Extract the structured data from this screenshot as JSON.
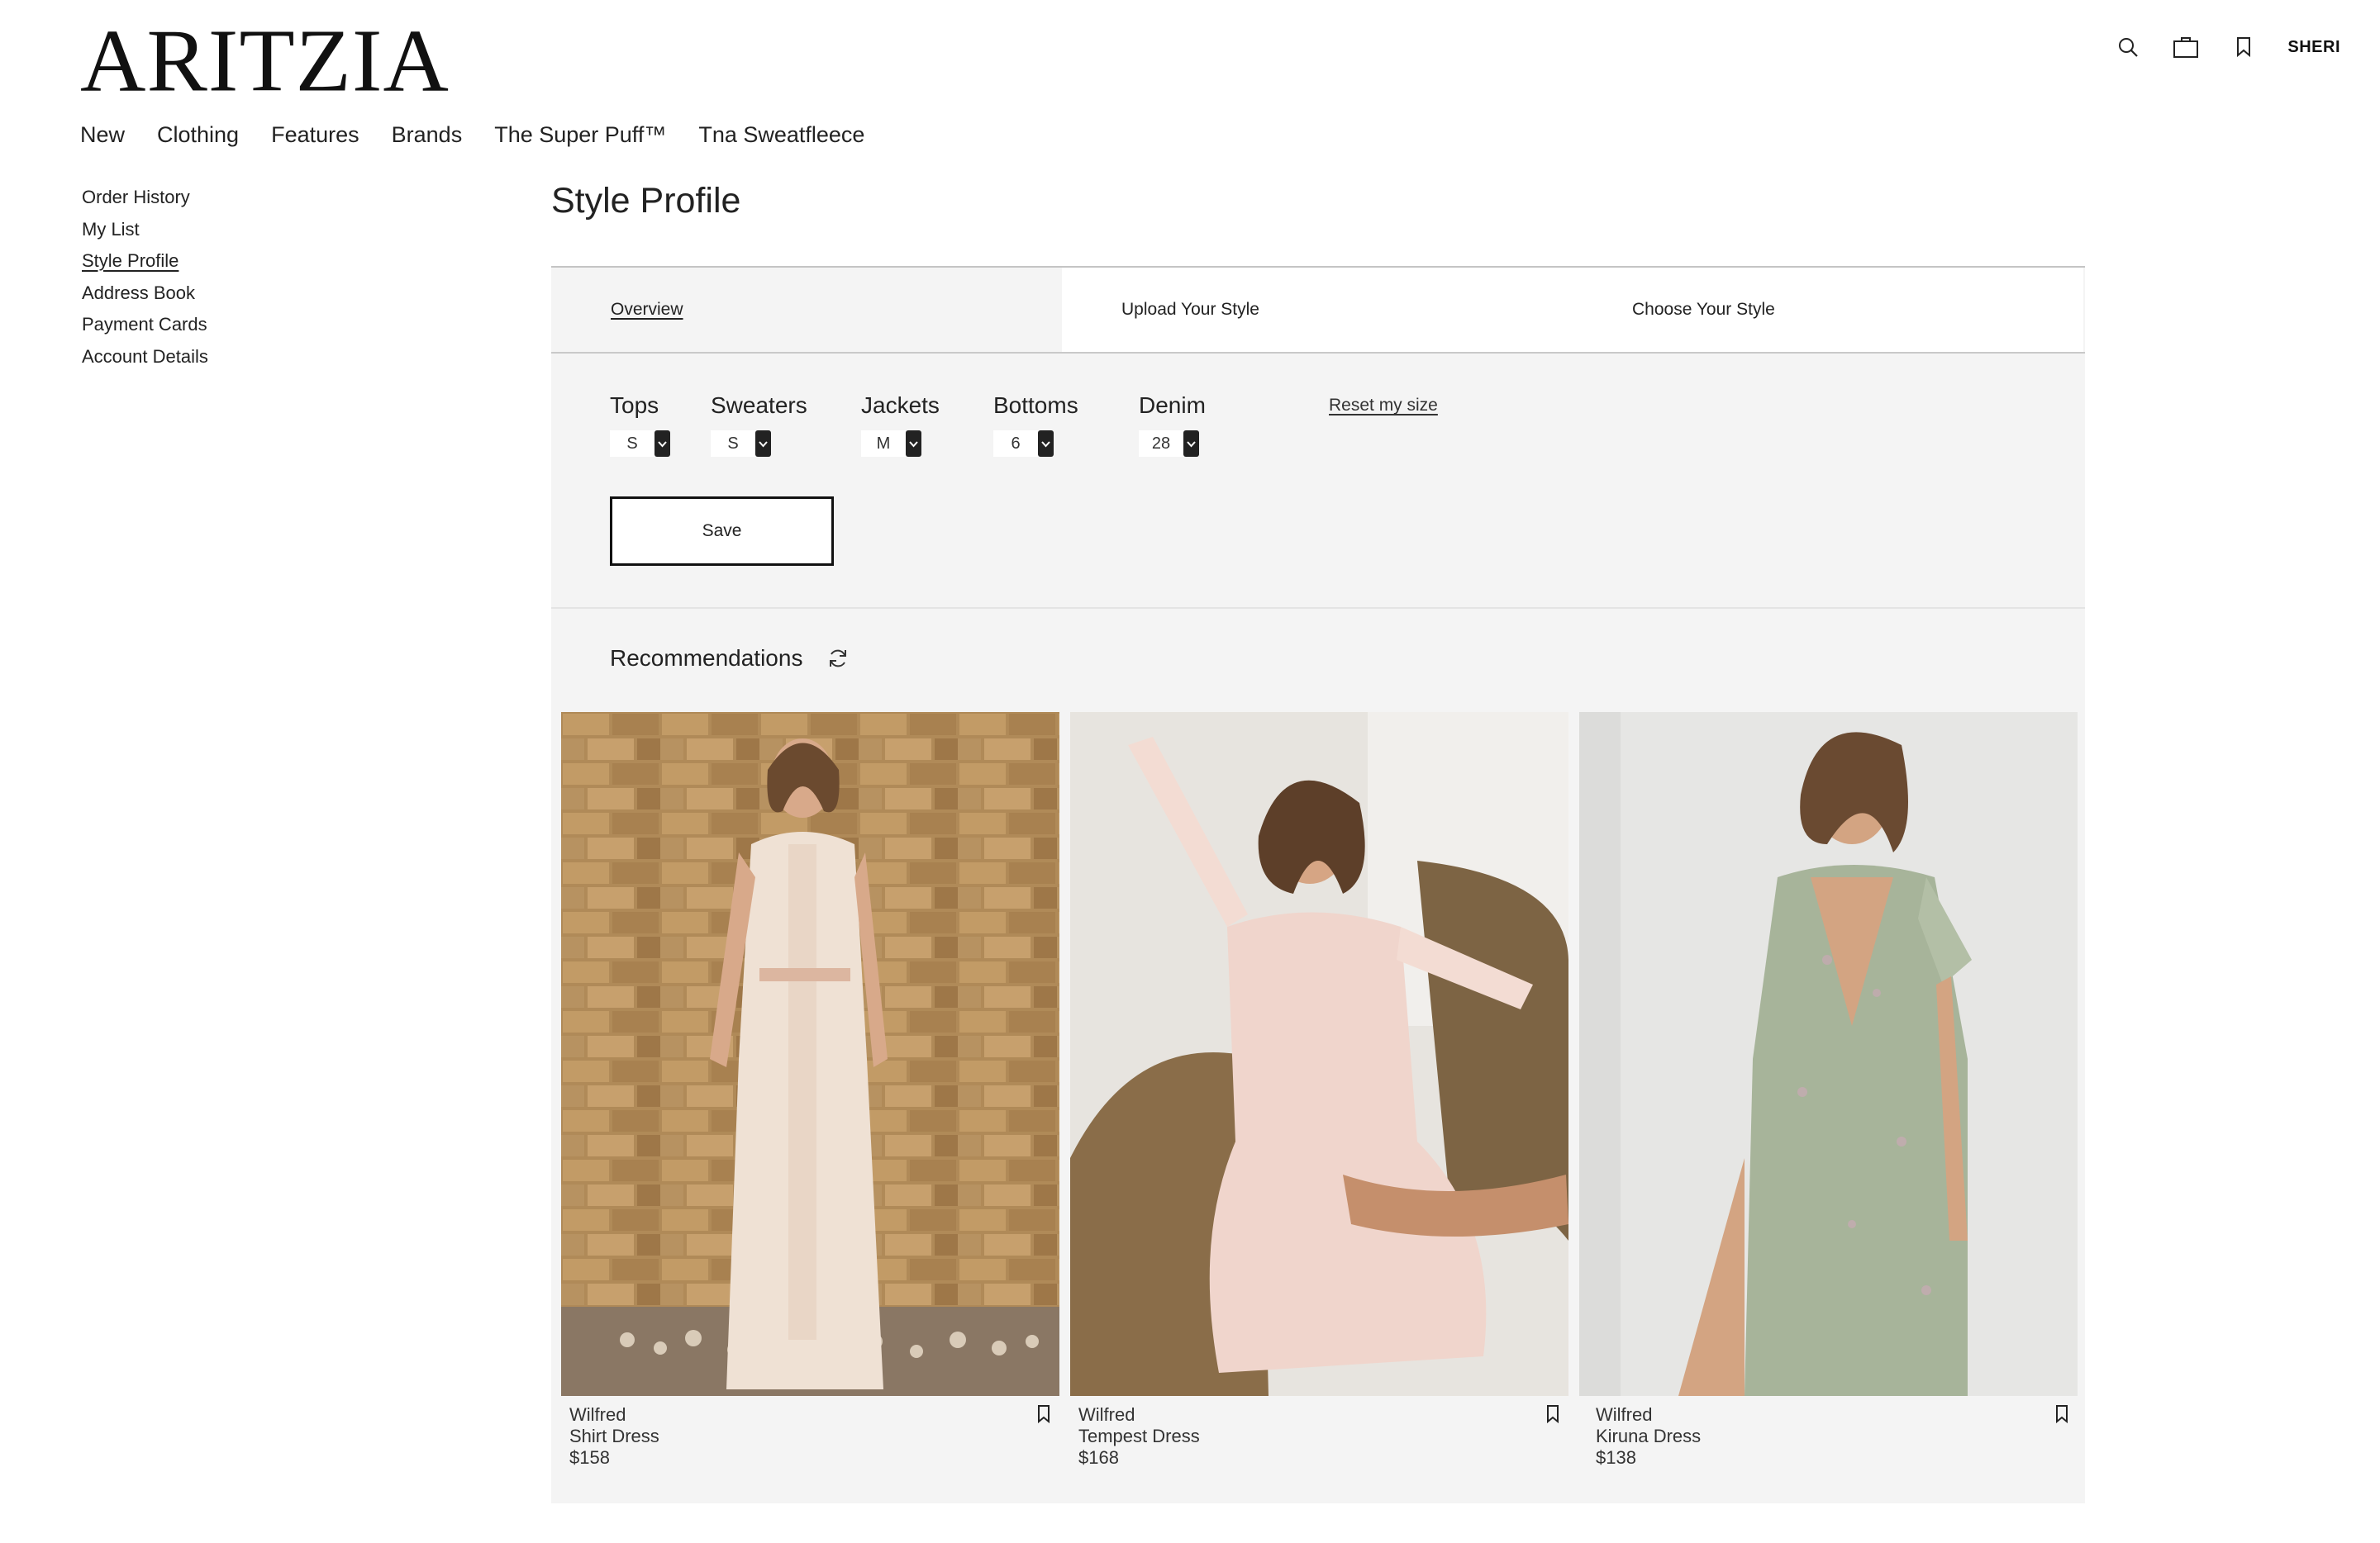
{
  "header": {
    "logo": "ARITZIA",
    "user_label": "SHERI",
    "icons": [
      "search-icon",
      "shopping-bag-icon",
      "bookmark-icon"
    ]
  },
  "main_nav": [
    "New",
    "Clothing",
    "Features",
    "Brands",
    "The Super Puff™",
    "Tna Sweatfleece"
  ],
  "sidebar": {
    "items": [
      {
        "label": "Order History"
      },
      {
        "label": "My List"
      },
      {
        "label": "Style Profile",
        "active": true
      },
      {
        "label": "Address Book"
      },
      {
        "label": "Payment Cards"
      },
      {
        "label": "Account Details"
      }
    ]
  },
  "page": {
    "title": "Style Profile",
    "tabs": [
      {
        "label": "Overview",
        "active": true
      },
      {
        "label": "Upload Your Style"
      },
      {
        "label": "Choose Your Style"
      }
    ],
    "sizes": [
      {
        "label": "Tops",
        "value": "S"
      },
      {
        "label": "Sweaters",
        "value": "S"
      },
      {
        "label": "Jackets",
        "value": "M"
      },
      {
        "label": "Bottoms",
        "value": "6"
      },
      {
        "label": "Denim",
        "value": "28"
      }
    ],
    "reset_label": "Reset my size",
    "save_label": "Save"
  },
  "recommendations": {
    "title": "Recommendations",
    "products": [
      {
        "brand": "Wilfred",
        "name": "Shirt Dress",
        "price": "$158"
      },
      {
        "brand": "Wilfred",
        "name": "Tempest Dress",
        "price": "$168"
      },
      {
        "brand": "Wilfred",
        "name": "Kiruna Dress",
        "price": "$138"
      }
    ]
  },
  "colors": {
    "text": "#222222",
    "panel_bg": "#f4f4f4",
    "button_border": "#111111"
  }
}
